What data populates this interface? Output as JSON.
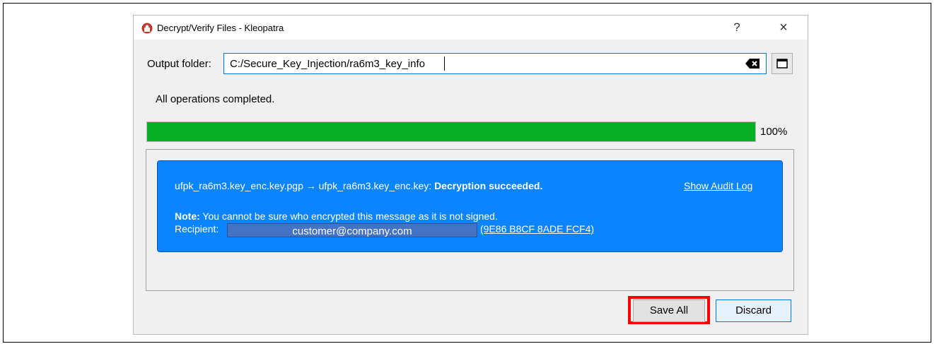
{
  "window": {
    "title": "Decrypt/Verify Files - Kleopatra",
    "help_glyph": "?",
    "close_glyph": "×",
    "icon": "kleopatra-app-icon"
  },
  "output": {
    "label": "Output folder:",
    "value": "C:/Secure_Key_Injection/ra6m3_key_info",
    "clear_icon": "clear-text-icon",
    "browse_icon": "folder-icon"
  },
  "status_text": "All operations completed.",
  "progress": {
    "fraction": 1.0,
    "label": "100%",
    "color": "#06b025"
  },
  "result": {
    "filenames": "ufpk_ra6m3.key_enc.key.pgp → ufpk_ra6m3.key_enc.key:",
    "status": "Decryption succeeded.",
    "audit_link": "Show Audit Log",
    "note_label": "Note:",
    "note_text": " You cannot be sure who encrypted this message as it is not signed.",
    "recipient_label": "Recipient:",
    "recipient_email": "customer@company.com",
    "recipient_keyid": "(9E86 B8CF 8ADE FCF4)",
    "card_color": "#0a84ff"
  },
  "buttons": {
    "save_all": "Save All",
    "discard": "Discard"
  },
  "highlight_color": "#ff0000"
}
